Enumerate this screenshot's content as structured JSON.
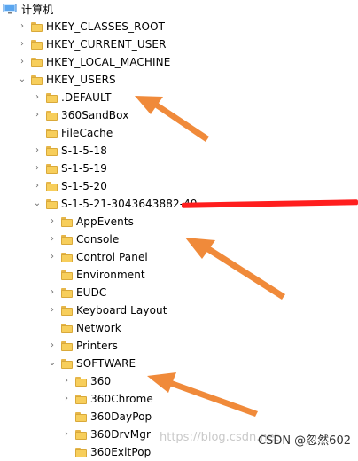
{
  "root": {
    "label": "计算机",
    "icon": "computer-icon"
  },
  "rows": [
    {
      "label": "HKEY_CLASSES_ROOT",
      "chevron": "collapsed"
    },
    {
      "label": "HKEY_CURRENT_USER",
      "chevron": "collapsed"
    },
    {
      "label": "HKEY_LOCAL_MACHINE",
      "chevron": "collapsed"
    },
    {
      "label": "HKEY_USERS",
      "chevron": "expanded"
    },
    {
      "label": ".DEFAULT",
      "chevron": "collapsed"
    },
    {
      "label": "360SandBox",
      "chevron": "collapsed"
    },
    {
      "label": "FileCache",
      "chevron": "none"
    },
    {
      "label": "S-1-5-18",
      "chevron": "collapsed"
    },
    {
      "label": "S-1-5-19",
      "chevron": "collapsed"
    },
    {
      "label": "S-1-5-20",
      "chevron": "collapsed"
    },
    {
      "label": "S-1-5-21-3043643882-49",
      "chevron": "expanded"
    },
    {
      "label": "AppEvents",
      "chevron": "collapsed"
    },
    {
      "label": "Console",
      "chevron": "collapsed"
    },
    {
      "label": "Control Panel",
      "chevron": "collapsed"
    },
    {
      "label": "Environment",
      "chevron": "none"
    },
    {
      "label": "EUDC",
      "chevron": "collapsed"
    },
    {
      "label": "Keyboard Layout",
      "chevron": "collapsed"
    },
    {
      "label": "Network",
      "chevron": "none"
    },
    {
      "label": "Printers",
      "chevron": "collapsed"
    },
    {
      "label": "SOFTWARE",
      "chevron": "expanded"
    },
    {
      "label": "360",
      "chevron": "collapsed"
    },
    {
      "label": "360Chrome",
      "chevron": "collapsed"
    },
    {
      "label": "360DayPop",
      "chevron": "none"
    },
    {
      "label": "360DrvMgr",
      "chevron": "collapsed"
    },
    {
      "label": "360ExitPop",
      "chevron": "none"
    }
  ],
  "watermark": "https://blog.csdn.net",
  "credit": "CSDN @忽然602",
  "colors": {
    "folder": "#f7ce5b",
    "arrow": "#f08a3a",
    "redaction": "#ff1e1e"
  }
}
